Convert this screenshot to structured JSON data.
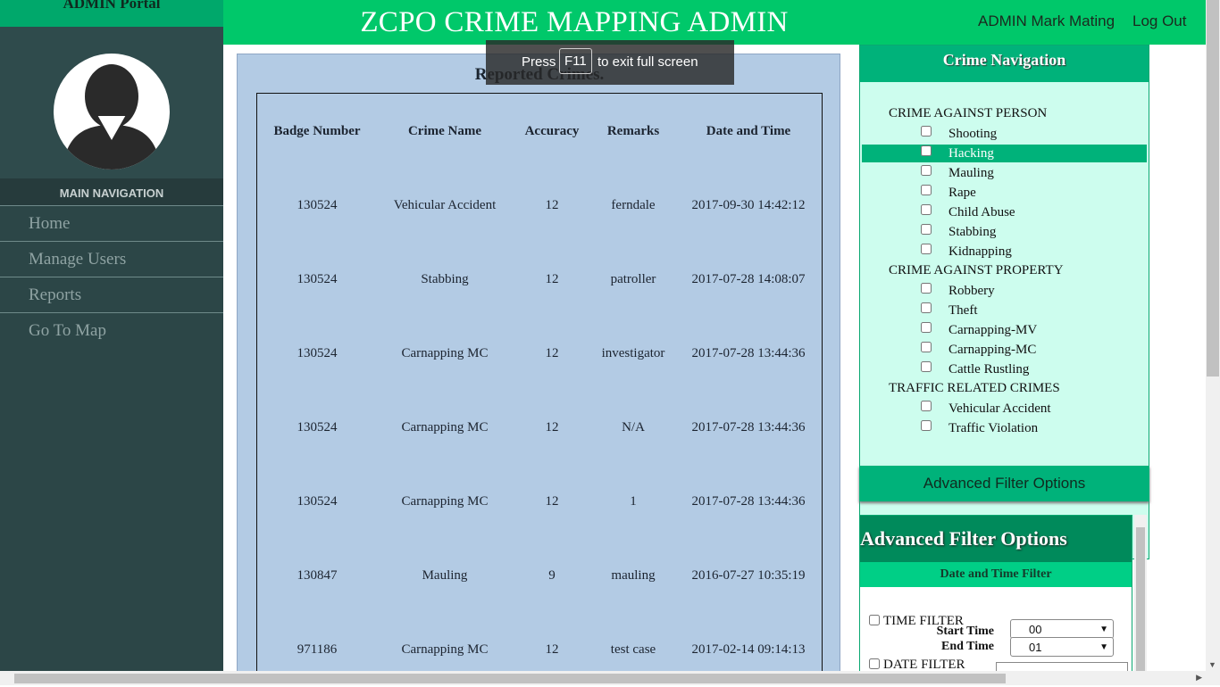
{
  "sidebar": {
    "brand": "ADMIN Portal",
    "nav_header": "MAIN NAVIGATION",
    "items": [
      {
        "label": "Home"
      },
      {
        "label": "Manage Users"
      },
      {
        "label": "Reports"
      },
      {
        "label": "Go To Map"
      }
    ]
  },
  "header": {
    "title": "ZCPO CRIME MAPPING ADMIN",
    "user": "ADMIN Mark Mating",
    "logout": "Log Out"
  },
  "toast": {
    "press": "Press",
    "key": "F11",
    "message": "to exit full screen"
  },
  "main": {
    "title": "Reported Crimes.",
    "columns": [
      "Badge Number",
      "Crime Name",
      "Accuracy",
      "Remarks",
      "Date and Time"
    ],
    "rows": [
      [
        "130524",
        "Vehicular Accident",
        "12",
        "ferndale",
        "2017-09-30 14:42:12"
      ],
      [
        "130524",
        "Stabbing",
        "12",
        "patroller",
        "2017-07-28 14:08:07"
      ],
      [
        "130524",
        "Carnapping MC",
        "12",
        "investigator",
        "2017-07-28 13:44:36"
      ],
      [
        "130524",
        "Carnapping MC",
        "12",
        "N/A",
        "2017-07-28 13:44:36"
      ],
      [
        "130524",
        "Carnapping MC",
        "12",
        "1",
        "2017-07-28 13:44:36"
      ],
      [
        "130847",
        "Mauling",
        "9",
        "mauling",
        "2016-07-27 10:35:19"
      ],
      [
        "971186",
        "Carnapping MC",
        "12",
        "test case",
        "2017-02-14 09:14:13"
      ]
    ]
  },
  "crime_nav": {
    "title": "Crime Navigation",
    "categories": [
      {
        "name": "CRIME AGAINST PERSON",
        "items": [
          "Shooting",
          "Hacking",
          "Mauling",
          "Rape",
          "Child Abuse",
          "Stabbing",
          "Kidnapping"
        ]
      },
      {
        "name": "CRIME AGAINST PROPERTY",
        "items": [
          "Robbery",
          "Theft",
          "Carnapping-MV",
          "Carnapping-MC",
          "Cattle Rustling"
        ]
      },
      {
        "name": "TRAFFIC RELATED CRIMES",
        "items": [
          "Vehicular Accident",
          "Traffic Violation"
        ]
      }
    ],
    "highlighted": "Hacking",
    "advanced_button": "Advanced Filter Options"
  },
  "advanced": {
    "title": "Advanced Filter Options",
    "section": "Date and Time Filter",
    "time_filter": "TIME FILTER",
    "start_label": "Start Time",
    "start_value": "00",
    "end_label": "End Time",
    "end_value": "01",
    "date_filter": "DATE FILTER"
  },
  "colors": {
    "sidebar": "#2c4647",
    "header": "#00c86a",
    "accent": "#00b27a",
    "panel": "#b3cbe4",
    "nav_bg": "#cdfdee"
  }
}
